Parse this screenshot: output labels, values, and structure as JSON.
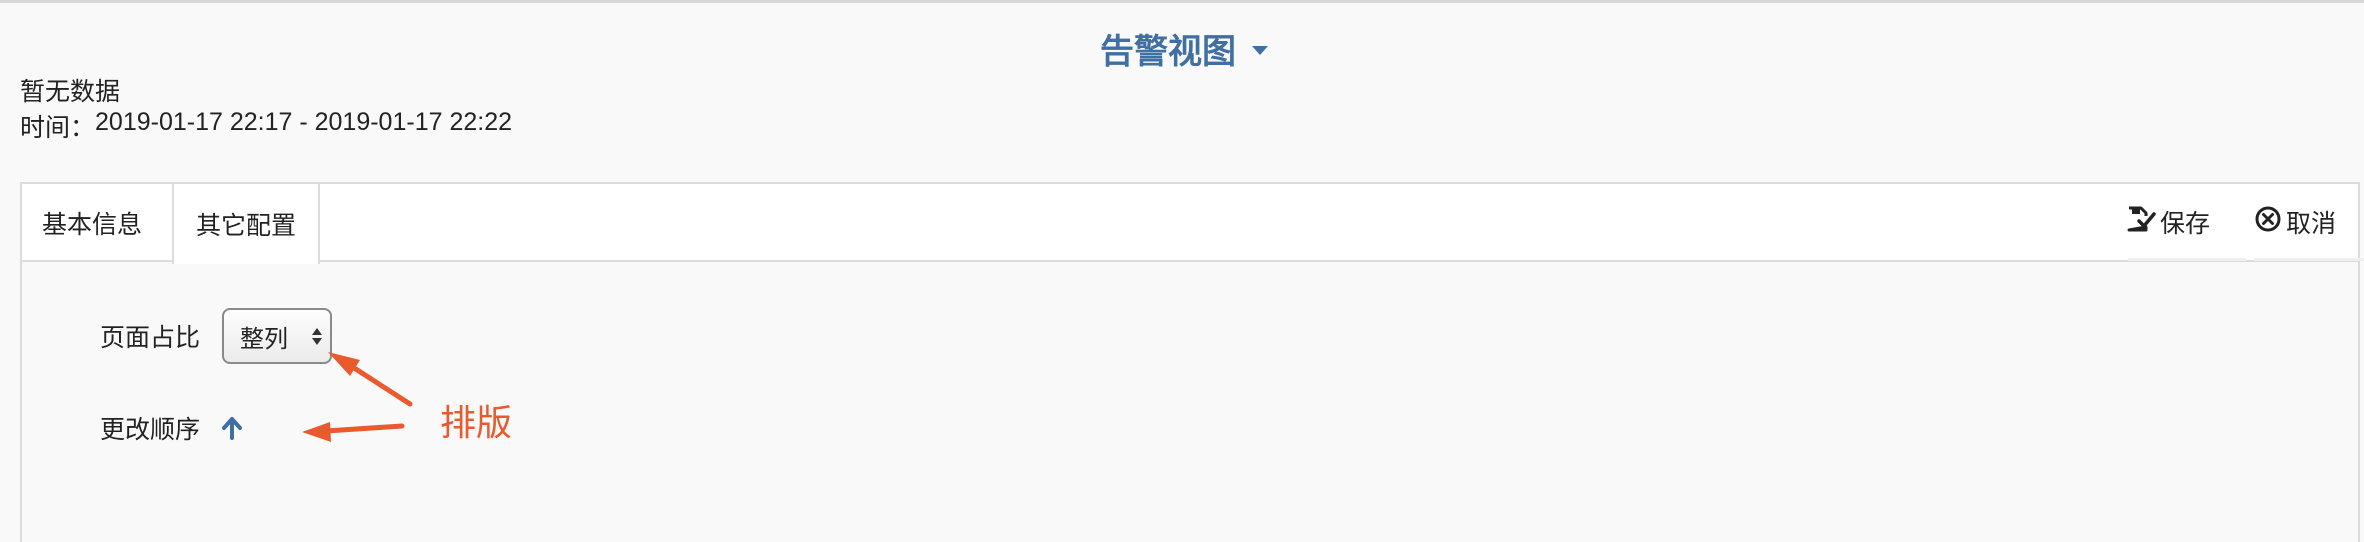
{
  "header": {
    "view_title": "告警视图"
  },
  "summary": {
    "no_data": "暂无数据",
    "time_label": "时间：",
    "time_range": "2019-01-17 22:17 - 2019-01-17 22:22"
  },
  "tabs": [
    {
      "label": "基本信息",
      "active": false
    },
    {
      "label": "其它配置",
      "active": true
    }
  ],
  "actions": {
    "save_label": "保存",
    "cancel_label": "取消",
    "save_icon": "save-check-icon",
    "cancel_icon": "circle-x-icon"
  },
  "form": {
    "ratio_label": "页面占比",
    "ratio_value": "整列",
    "order_label": "更改顺序",
    "order_icon": "arrow-up-icon"
  },
  "annotation": {
    "text": "排版",
    "color": "#e95a2e"
  },
  "colors": {
    "accent": "#3f6fa3",
    "annotation": "#e95a2e"
  }
}
